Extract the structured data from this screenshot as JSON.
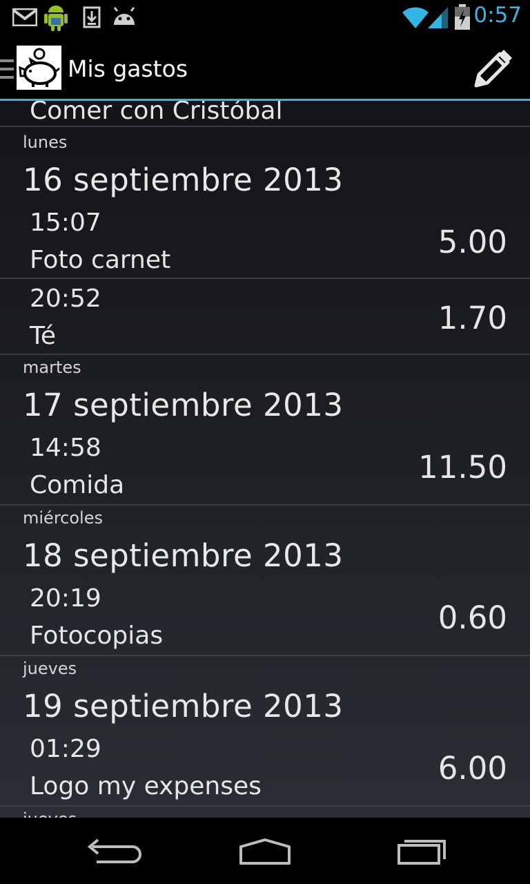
{
  "status_bar": {
    "time": "0:57",
    "icons": [
      "gmail-icon",
      "android-icon",
      "download-icon",
      "android-debug-icon",
      "wifi-icon",
      "signal-icon",
      "battery-charging-icon"
    ],
    "accent_color": "#33b5e5"
  },
  "action_bar": {
    "title": "Mis gastos",
    "logo_icon": "piggy-bank-icon",
    "edit_icon": "pencil-icon"
  },
  "list": {
    "partial_top": {
      "desc": "Comer con Cristóbal"
    },
    "rows": [
      {
        "weekday": "lunes",
        "date": "16 septiembre 2013",
        "time": "15:07",
        "desc": "Foto carnet",
        "amount": "5.00"
      },
      {
        "weekday": "",
        "date": "",
        "time": "20:52",
        "desc": "Té",
        "amount": "1.70"
      },
      {
        "weekday": "martes",
        "date": "17 septiembre 2013",
        "time": "14:58",
        "desc": "Comida",
        "amount": "11.50"
      },
      {
        "weekday": "miércoles",
        "date": "18 septiembre 2013",
        "time": "20:19",
        "desc": "Fotocopias",
        "amount": "0.60"
      },
      {
        "weekday": "jueves",
        "date": "19 septiembre 2013",
        "time": "01:29",
        "desc": "Logo my expenses",
        "amount": "6.00"
      }
    ],
    "partial_bottom": {
      "weekday": "jueves"
    }
  },
  "nav_bar": {
    "icons": [
      "back-icon",
      "home-icon",
      "recent-apps-icon"
    ]
  }
}
